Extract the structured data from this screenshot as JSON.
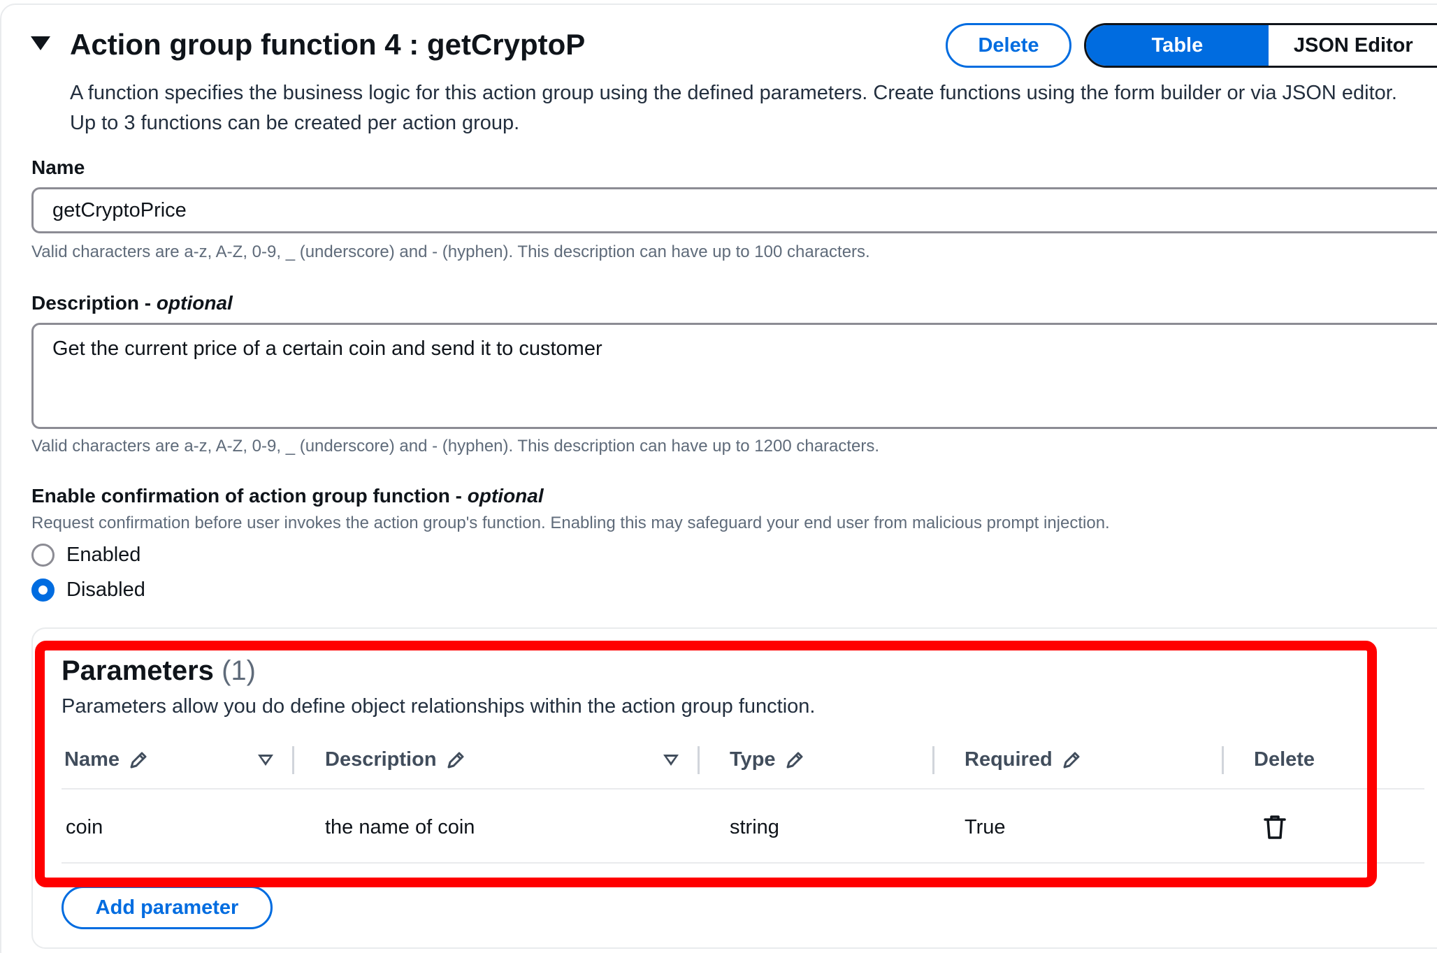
{
  "header": {
    "title": "Action group function 4 : getCryptoP",
    "description_line1": "A function specifies the business logic for this action group using the defined parameters. Create functions using the form builder or via JSON editor.",
    "description_line2": "Up to 3 functions can be created per action group.",
    "delete_label": "Delete",
    "toggle": {
      "table_label": "Table",
      "json_label": "JSON Editor",
      "selected": "Table"
    }
  },
  "name_field": {
    "label": "Name",
    "value": "getCryptoPrice",
    "hint": "Valid characters are a-z, A-Z, 0-9, _ (underscore) and - (hyphen). This description can have up to 100 characters."
  },
  "description_field": {
    "label": "Description",
    "label_suffix": "optional",
    "value": "Get the current price of a certain coin and send it to customer",
    "hint": "Valid characters are a-z, A-Z, 0-9, _ (underscore) and - (hyphen). This description can have up to 1200 characters."
  },
  "confirmation": {
    "label": "Enable confirmation of action group function",
    "label_suffix": "optional",
    "hint": "Request confirmation before user invokes the action group's function. Enabling this may safeguard your end user from malicious prompt injection.",
    "options": [
      "Enabled",
      "Disabled"
    ],
    "selected": "Disabled"
  },
  "parameters": {
    "title": "Parameters",
    "count": "(1)",
    "description": "Parameters allow you do define object relationships within the action group function.",
    "columns": [
      "Name",
      "Description",
      "Type",
      "Required",
      "Delete"
    ],
    "rows": [
      {
        "name": "coin",
        "description": "the name of coin",
        "type": "string",
        "required": "True"
      }
    ],
    "add_label": "Add parameter"
  },
  "colors": {
    "accent": "#006ce0",
    "highlight": "#ff0000",
    "text": "#0f141a",
    "muted": "#5f6b7a"
  }
}
